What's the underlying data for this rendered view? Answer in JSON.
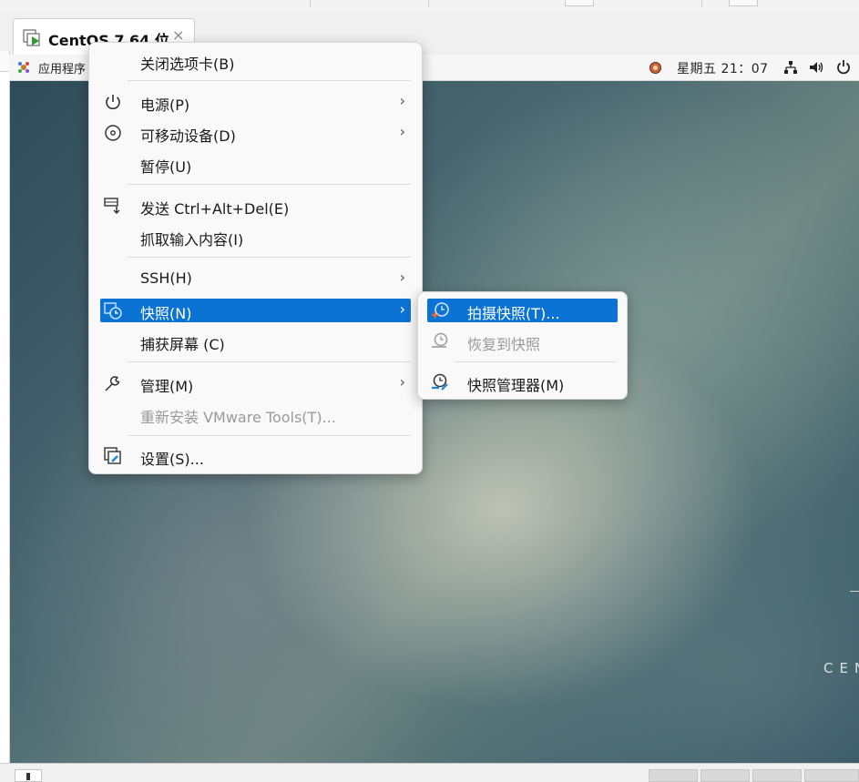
{
  "tab": {
    "title": "CentOS 7 64 位",
    "close": "×"
  },
  "guest": {
    "apps_menu": "应用程序",
    "clock": "星期五 21：07",
    "desktop_brand": "CEN"
  },
  "context_menu": {
    "items": [
      {
        "label": "关闭选项卡(B)"
      },
      {
        "label": "电源(P)",
        "submenu": true
      },
      {
        "label": "可移动设备(D)",
        "submenu": true
      },
      {
        "label": "暂停(U)"
      },
      {
        "label": "发送 Ctrl+Alt+Del(E)"
      },
      {
        "label": "抓取输入内容(I)"
      },
      {
        "label": "SSH(H)",
        "submenu": true
      },
      {
        "label": "快照(N)",
        "submenu": true,
        "highlighted": true
      },
      {
        "label": "捕获屏幕 (C)"
      },
      {
        "label": "管理(M)",
        "submenu": true
      },
      {
        "label": "重新安装 VMware Tools(T)...",
        "disabled": true
      },
      {
        "label": "设置(S)..."
      }
    ],
    "arrow": "›"
  },
  "snapshot_submenu": {
    "items": [
      {
        "label": "拍摄快照(T)...",
        "highlighted": true
      },
      {
        "label": "恢复到快照",
        "disabled": true
      },
      {
        "label": "快照管理器(M)"
      }
    ]
  },
  "colors": {
    "highlight": "#0a73d4",
    "menu_bg": "#f9f9f9"
  }
}
